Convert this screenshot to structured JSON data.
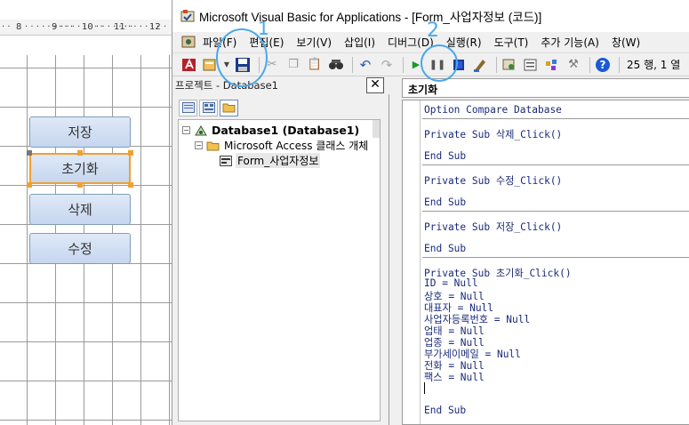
{
  "designer": {
    "ruler_marks": [
      "8",
      "9",
      "10",
      "11",
      "12"
    ],
    "buttons": [
      {
        "label": "저장"
      },
      {
        "label": "초기화"
      },
      {
        "label": "삭제"
      },
      {
        "label": "수정"
      }
    ]
  },
  "vba": {
    "title": "Microsoft Visual Basic for Applications - [Form_사업자정보 (코드)]",
    "menu": [
      "파일(F)",
      "편집(E)",
      "보기(V)",
      "삽입(I)",
      "디버그(D)",
      "실행(R)",
      "도구(T)",
      "추가 기능(A)",
      "창(W)"
    ],
    "status": "25 행, 1 열",
    "project": {
      "title": "프로젝트 - Database1",
      "close": "✕",
      "tree": {
        "root": "Database1 (Database1)",
        "folder": "Microsoft Access 클래스 개체",
        "item": "Form_사업자정보"
      }
    },
    "code": {
      "object": "초기화",
      "lines": {
        "option": "Option Compare Database",
        "del_sub": "Private Sub 삭제_Click()",
        "del_end": "End Sub",
        "mod_sub": "Private Sub 수정_Click()",
        "mod_end": "End Sub",
        "save_sub": "Private Sub 저장_Click()",
        "save_end": "End Sub",
        "init_sub": "Private Sub 초기화_Click()",
        "l1": "ID = Null",
        "l2": "상호 = Null",
        "l3": "대표자 = Null",
        "l4": "사업자등록번호 = Null",
        "l5": "업태 = Null",
        "l6": "업종 = Null",
        "l7": "부가세이메일 = Null",
        "l8": "전화 = Null",
        "l9": "팩스 = Null",
        "init_end": "End Sub"
      }
    }
  },
  "annotations": {
    "mark1": "1",
    "mark2": "2",
    "color": "#4aa8ea"
  }
}
